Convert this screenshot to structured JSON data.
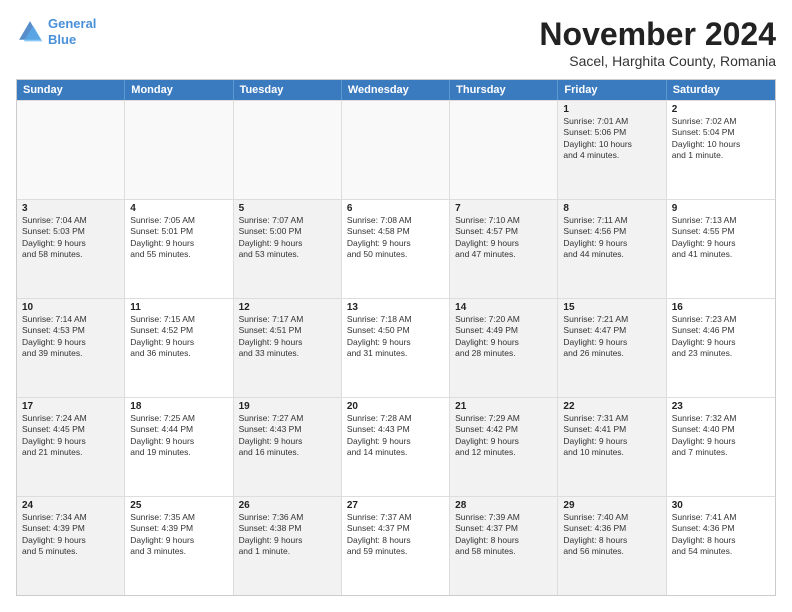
{
  "logo": {
    "line1": "General",
    "line2": "Blue"
  },
  "title": "November 2024",
  "subtitle": "Sacel, Harghita County, Romania",
  "headers": [
    "Sunday",
    "Monday",
    "Tuesday",
    "Wednesday",
    "Thursday",
    "Friday",
    "Saturday"
  ],
  "rows": [
    [
      {
        "day": "",
        "info": "",
        "empty": true
      },
      {
        "day": "",
        "info": "",
        "empty": true
      },
      {
        "day": "",
        "info": "",
        "empty": true
      },
      {
        "day": "",
        "info": "",
        "empty": true
      },
      {
        "day": "",
        "info": "",
        "empty": true
      },
      {
        "day": "1",
        "info": "Sunrise: 7:01 AM\nSunset: 5:06 PM\nDaylight: 10 hours\nand 4 minutes.",
        "shade": true
      },
      {
        "day": "2",
        "info": "Sunrise: 7:02 AM\nSunset: 5:04 PM\nDaylight: 10 hours\nand 1 minute.",
        "shade": false
      }
    ],
    [
      {
        "day": "3",
        "info": "Sunrise: 7:04 AM\nSunset: 5:03 PM\nDaylight: 9 hours\nand 58 minutes.",
        "shade": true
      },
      {
        "day": "4",
        "info": "Sunrise: 7:05 AM\nSunset: 5:01 PM\nDaylight: 9 hours\nand 55 minutes.",
        "shade": false
      },
      {
        "day": "5",
        "info": "Sunrise: 7:07 AM\nSunset: 5:00 PM\nDaylight: 9 hours\nand 53 minutes.",
        "shade": true
      },
      {
        "day": "6",
        "info": "Sunrise: 7:08 AM\nSunset: 4:58 PM\nDaylight: 9 hours\nand 50 minutes.",
        "shade": false
      },
      {
        "day": "7",
        "info": "Sunrise: 7:10 AM\nSunset: 4:57 PM\nDaylight: 9 hours\nand 47 minutes.",
        "shade": true
      },
      {
        "day": "8",
        "info": "Sunrise: 7:11 AM\nSunset: 4:56 PM\nDaylight: 9 hours\nand 44 minutes.",
        "shade": true
      },
      {
        "day": "9",
        "info": "Sunrise: 7:13 AM\nSunset: 4:55 PM\nDaylight: 9 hours\nand 41 minutes.",
        "shade": false
      }
    ],
    [
      {
        "day": "10",
        "info": "Sunrise: 7:14 AM\nSunset: 4:53 PM\nDaylight: 9 hours\nand 39 minutes.",
        "shade": true
      },
      {
        "day": "11",
        "info": "Sunrise: 7:15 AM\nSunset: 4:52 PM\nDaylight: 9 hours\nand 36 minutes.",
        "shade": false
      },
      {
        "day": "12",
        "info": "Sunrise: 7:17 AM\nSunset: 4:51 PM\nDaylight: 9 hours\nand 33 minutes.",
        "shade": true
      },
      {
        "day": "13",
        "info": "Sunrise: 7:18 AM\nSunset: 4:50 PM\nDaylight: 9 hours\nand 31 minutes.",
        "shade": false
      },
      {
        "day": "14",
        "info": "Sunrise: 7:20 AM\nSunset: 4:49 PM\nDaylight: 9 hours\nand 28 minutes.",
        "shade": true
      },
      {
        "day": "15",
        "info": "Sunrise: 7:21 AM\nSunset: 4:47 PM\nDaylight: 9 hours\nand 26 minutes.",
        "shade": true
      },
      {
        "day": "16",
        "info": "Sunrise: 7:23 AM\nSunset: 4:46 PM\nDaylight: 9 hours\nand 23 minutes.",
        "shade": false
      }
    ],
    [
      {
        "day": "17",
        "info": "Sunrise: 7:24 AM\nSunset: 4:45 PM\nDaylight: 9 hours\nand 21 minutes.",
        "shade": true
      },
      {
        "day": "18",
        "info": "Sunrise: 7:25 AM\nSunset: 4:44 PM\nDaylight: 9 hours\nand 19 minutes.",
        "shade": false
      },
      {
        "day": "19",
        "info": "Sunrise: 7:27 AM\nSunset: 4:43 PM\nDaylight: 9 hours\nand 16 minutes.",
        "shade": true
      },
      {
        "day": "20",
        "info": "Sunrise: 7:28 AM\nSunset: 4:43 PM\nDaylight: 9 hours\nand 14 minutes.",
        "shade": false
      },
      {
        "day": "21",
        "info": "Sunrise: 7:29 AM\nSunset: 4:42 PM\nDaylight: 9 hours\nand 12 minutes.",
        "shade": true
      },
      {
        "day": "22",
        "info": "Sunrise: 7:31 AM\nSunset: 4:41 PM\nDaylight: 9 hours\nand 10 minutes.",
        "shade": true
      },
      {
        "day": "23",
        "info": "Sunrise: 7:32 AM\nSunset: 4:40 PM\nDaylight: 9 hours\nand 7 minutes.",
        "shade": false
      }
    ],
    [
      {
        "day": "24",
        "info": "Sunrise: 7:34 AM\nSunset: 4:39 PM\nDaylight: 9 hours\nand 5 minutes.",
        "shade": true
      },
      {
        "day": "25",
        "info": "Sunrise: 7:35 AM\nSunset: 4:39 PM\nDaylight: 9 hours\nand 3 minutes.",
        "shade": false
      },
      {
        "day": "26",
        "info": "Sunrise: 7:36 AM\nSunset: 4:38 PM\nDaylight: 9 hours\nand 1 minute.",
        "shade": true
      },
      {
        "day": "27",
        "info": "Sunrise: 7:37 AM\nSunset: 4:37 PM\nDaylight: 8 hours\nand 59 minutes.",
        "shade": false
      },
      {
        "day": "28",
        "info": "Sunrise: 7:39 AM\nSunset: 4:37 PM\nDaylight: 8 hours\nand 58 minutes.",
        "shade": true
      },
      {
        "day": "29",
        "info": "Sunrise: 7:40 AM\nSunset: 4:36 PM\nDaylight: 8 hours\nand 56 minutes.",
        "shade": true
      },
      {
        "day": "30",
        "info": "Sunrise: 7:41 AM\nSunset: 4:36 PM\nDaylight: 8 hours\nand 54 minutes.",
        "shade": false
      }
    ]
  ]
}
